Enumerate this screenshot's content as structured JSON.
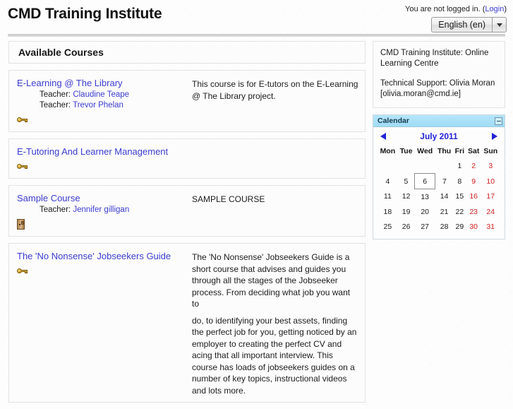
{
  "header": {
    "site_title": "CMD Training Institute",
    "login_status": "You are not logged in.",
    "login_open_paren": "(",
    "login_link": "Login",
    "login_close_paren": ")",
    "language_selected": "English (en)",
    "language_caret_icon": "chevron-down-icon"
  },
  "main": {
    "courses_heading": "Available Courses",
    "courses": [
      {
        "name": "E-Learning @ The Library",
        "teacher_label_1": "Teacher:",
        "teacher_name_1": "Claudine Teape",
        "teacher_label_2": "Teacher:",
        "teacher_name_2": "Trevor Phelan",
        "access_icon": "key-icon",
        "summary": "This course is for E-tutors on the E-Learning @ The Library project."
      },
      {
        "name": "E-Tutoring And Learner Management",
        "access_icon": "key-icon",
        "summary": ""
      },
      {
        "name": "Sample Course",
        "teacher_label_1": "Teacher:",
        "teacher_name_1": "Jennifer gilligan",
        "access_icon": "guest-door-icon",
        "summary": "SAMPLE COURSE"
      },
      {
        "name": "The 'No Nonsense' Jobseekers Guide",
        "access_icon": "key-icon",
        "summary_p1": "The 'No Nonsense' Jobseekers Guide is a short course that advises and guides you through all the stages of the Jobseeker process. From deciding what job you want to",
        "summary_p2": "do, to identifying your best assets, finding the perfect job for you, getting noticed by an employer to creating the perfect CV and acing that all important interview. This course has loads of jobseekers guides on a number of key topics, instructional videos and lots more."
      }
    ]
  },
  "sidebar": {
    "info_line_1": "CMD Training Institute: Online Learning Centre",
    "info_line_2": "Technical Support: Olivia Moran [olivia.moran@cmd.ie]",
    "calendar": {
      "title": "Calendar",
      "minimize_icon": "minimize-icon",
      "prev_icon": "triangle-left-icon",
      "next_icon": "triangle-right-icon",
      "month_label": "July 2011",
      "day_headers": [
        "Mon",
        "Tue",
        "Wed",
        "Thu",
        "Fri",
        "Sat",
        "Sun"
      ],
      "weeks": [
        [
          "",
          "",
          "",
          "",
          "1",
          "2",
          "3"
        ],
        [
          "4",
          "5",
          "6",
          "7",
          "8",
          "9",
          "10"
        ],
        [
          "11",
          "12",
          "13",
          "14",
          "15",
          "16",
          "17"
        ],
        [
          "18",
          "19",
          "20",
          "21",
          "22",
          "23",
          "24"
        ],
        [
          "25",
          "26",
          "27",
          "28",
          "29",
          "30",
          "31"
        ]
      ],
      "today": "6",
      "weekend_columns": [
        5,
        6
      ],
      "weekend_color": "#d21f1f"
    }
  },
  "colors": {
    "link": "#3b3bd1",
    "calendar_header": "#9fdcf6",
    "calendar_link": "#2222d8",
    "page_background": "#fdfdfd"
  }
}
